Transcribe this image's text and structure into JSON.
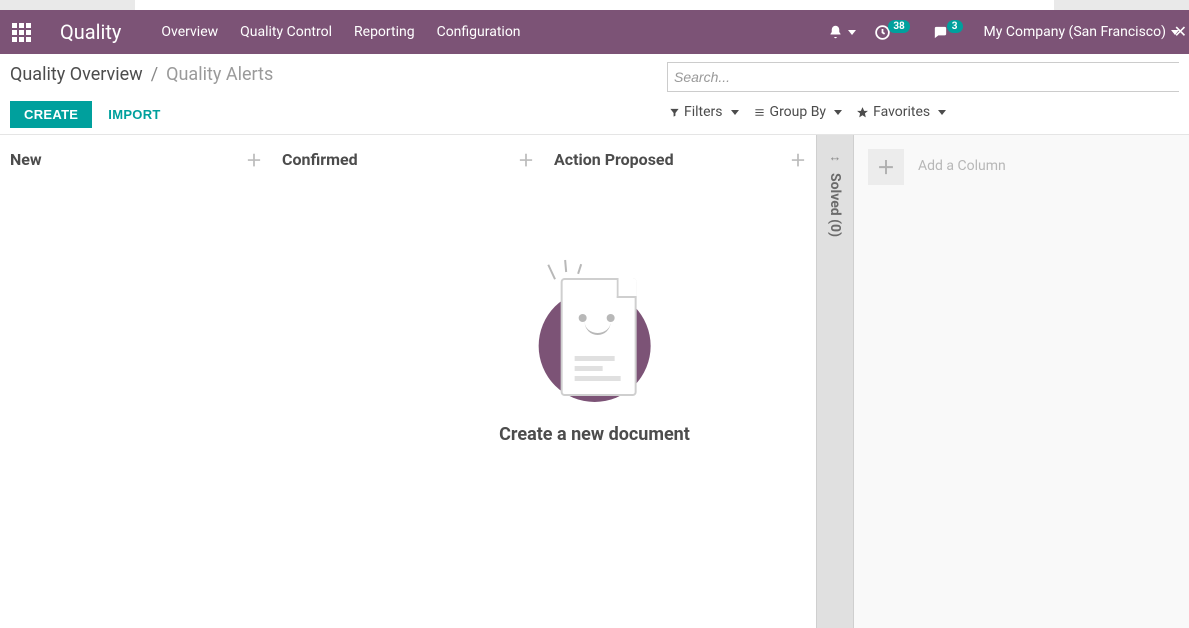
{
  "navbar": {
    "brand": "Quality",
    "menu": [
      "Overview",
      "Quality Control",
      "Reporting",
      "Configuration"
    ],
    "activity_count": "38",
    "messages_count": "3",
    "company": "My Company (San Francisco)"
  },
  "breadcrumb": {
    "parent": "Quality Overview",
    "sep": "/",
    "current": "Quality Alerts"
  },
  "buttons": {
    "create": "CREATE",
    "import": "IMPORT"
  },
  "search": {
    "placeholder": "Search..."
  },
  "filters": {
    "filters": "Filters",
    "groupby": "Group By",
    "favorites": "Favorites"
  },
  "kanban": {
    "columns": [
      "New",
      "Confirmed",
      "Action Proposed"
    ],
    "folded": {
      "title": "Solved",
      "count": "(0)"
    },
    "add_column": "Add a Column"
  },
  "empty_state": {
    "title": "Create a new document"
  }
}
